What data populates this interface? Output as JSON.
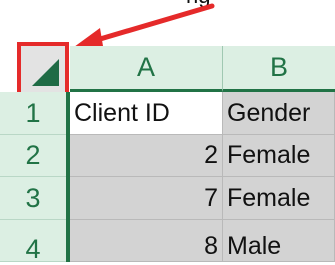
{
  "caption": {
    "text": "ng"
  },
  "corner": {
    "select_all_icon": "select-all-triangle-icon"
  },
  "columns": [
    {
      "label": "A"
    },
    {
      "label": "B"
    }
  ],
  "rows": [
    {
      "number": "1",
      "a": "Client ID",
      "b": "Gender"
    },
    {
      "number": "2",
      "a": "2",
      "b": "Female"
    },
    {
      "number": "3",
      "a": "7",
      "b": "Female"
    },
    {
      "number": "4",
      "a": "8",
      "b": "Male"
    }
  ],
  "colors": {
    "accent_green": "#217346",
    "annotation_red": "#e52a2a"
  }
}
